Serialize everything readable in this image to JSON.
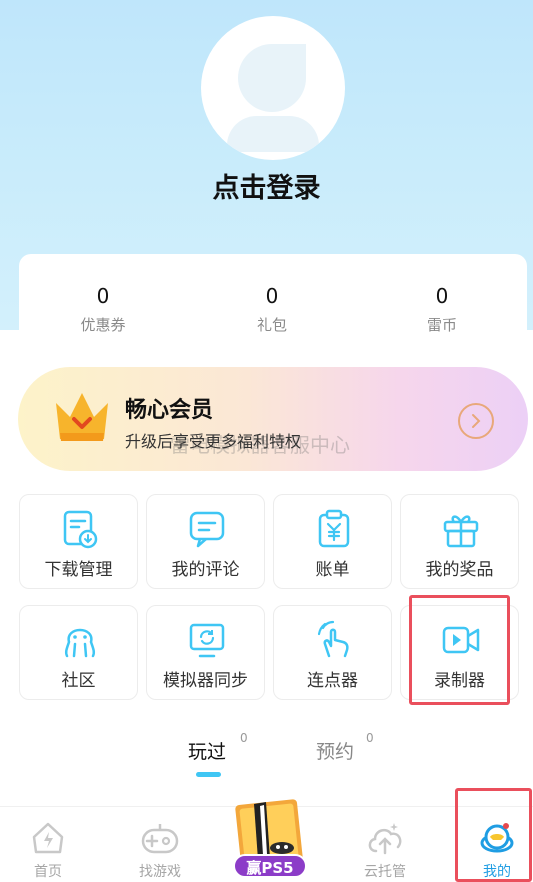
{
  "header": {
    "login_title": "点击登录"
  },
  "stats": [
    {
      "value": "0",
      "label": "优惠券"
    },
    {
      "value": "0",
      "label": "礼包"
    },
    {
      "value": "0",
      "label": "雷币"
    }
  ],
  "vip": {
    "title": "畅心会员",
    "subtitle": "升级后享受更多福利特权",
    "watermark": "雷电模拟器客服中心"
  },
  "grid": [
    {
      "label": "下载管理",
      "icon": "download-doc-icon"
    },
    {
      "label": "我的评论",
      "icon": "comment-icon"
    },
    {
      "label": "账单",
      "icon": "bill-icon"
    },
    {
      "label": "我的奖品",
      "icon": "gift-icon"
    },
    {
      "label": "社区",
      "icon": "community-icon"
    },
    {
      "label": "模拟器同步",
      "icon": "sync-icon"
    },
    {
      "label": "连点器",
      "icon": "auto-click-icon"
    },
    {
      "label": "录制器",
      "icon": "video-recorder-icon"
    }
  ],
  "tabs": [
    {
      "label": "玩过",
      "count": "0"
    },
    {
      "label": "预约",
      "count": "0"
    }
  ],
  "bottom_nav": [
    {
      "label": "首页",
      "icon": "home-icon"
    },
    {
      "label": "找游戏",
      "icon": "gamepad-icon"
    },
    {
      "label": "赢PS5",
      "icon": "ps5-promo-icon"
    },
    {
      "label": "云托管",
      "icon": "cloud-icon"
    },
    {
      "label": "我的",
      "icon": "profile-icon"
    }
  ],
  "colors": {
    "accent": "#3fc6f4",
    "highlight": "#ea4f5c",
    "active_nav": "#1f9de3"
  }
}
